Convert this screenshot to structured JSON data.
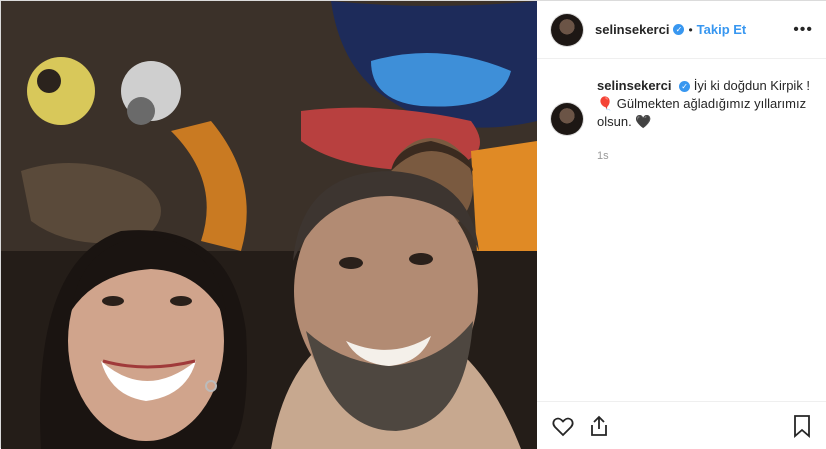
{
  "post": {
    "username": "selinsekerci",
    "verified_badge": "✓",
    "separator": "•",
    "follow_label": "Takip Et",
    "more_label": "•••",
    "caption_line1": "İyi ki doğdun Kirpik !",
    "caption_line2": "🎈 Gülmekten ağladığımız yıllarımız",
    "caption_line3": "olsun. 🖤",
    "timestamp": "1s"
  },
  "icons": {
    "like": "heart-icon",
    "share": "share-icon",
    "save": "bookmark-icon"
  },
  "colors": {
    "accent": "#3897f0",
    "text": "#262626",
    "muted": "#999999",
    "border": "#dbdbdb"
  }
}
